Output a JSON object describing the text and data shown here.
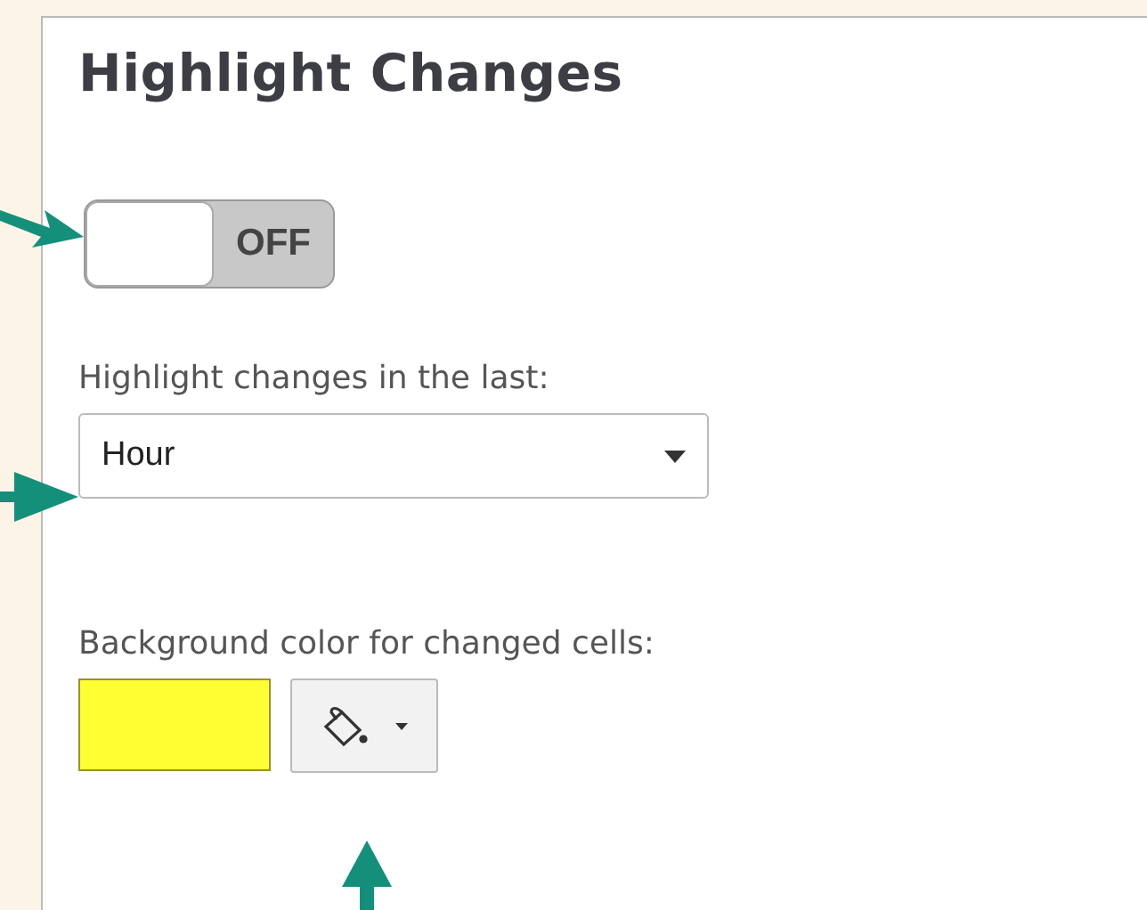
{
  "title": "Highlight Changes",
  "toggle": {
    "on": false,
    "label": "OFF"
  },
  "period": {
    "label": "Highlight changes in the last:",
    "value": "Hour"
  },
  "background": {
    "label": "Background color for changed cells:",
    "color": "#ffff33"
  }
}
